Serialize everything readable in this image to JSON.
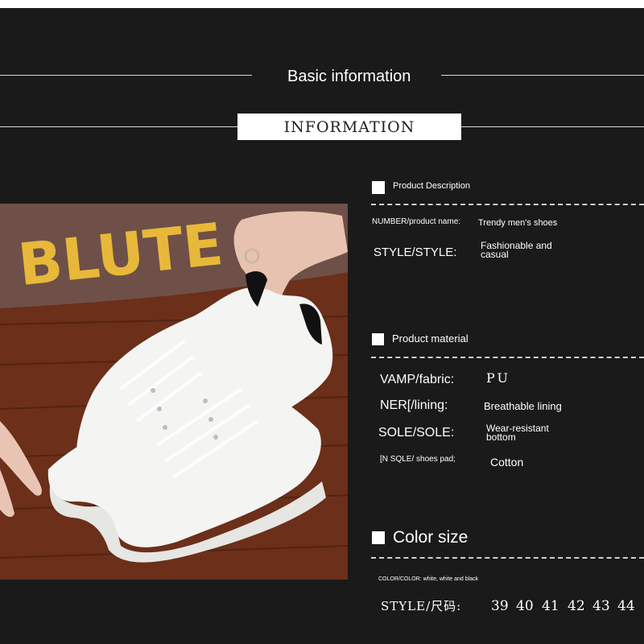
{
  "header": {
    "title": "Basic information",
    "banner": "INFORMATION"
  },
  "product_description": {
    "title": "Product Description",
    "rows": [
      {
        "label": "NUMBER/product name:",
        "value": "Trendy men's shoes"
      },
      {
        "label": "STYLE/STYLE:",
        "value": "Fashionable and casual"
      }
    ]
  },
  "product_material": {
    "title": "Product material",
    "rows": [
      {
        "label": "VAMP/fabric:",
        "value": "PU"
      },
      {
        "label": "NER[/lining:",
        "value": "Breathable lining"
      },
      {
        "label": "SOLE/SOLE:",
        "value": "Wear-resistant bottom"
      },
      {
        "label": "[N SQLE/ shoes pad;",
        "value": "Cotton"
      }
    ]
  },
  "color_size": {
    "title": "Color size",
    "color_text": "COLOR/COLOR: white, white and black",
    "size_label": "STYLE/尺码:",
    "sizes": [
      "39",
      "40",
      "41",
      "42",
      "43",
      "44"
    ]
  },
  "photo": {
    "sweater_text": "BLUTE",
    "colors": {
      "shoe": "#f4f4f2",
      "heel_tab": "#111111",
      "wood": "#6b2f1a",
      "sweater": "#6e5048",
      "letters": "#e8b83a"
    }
  }
}
